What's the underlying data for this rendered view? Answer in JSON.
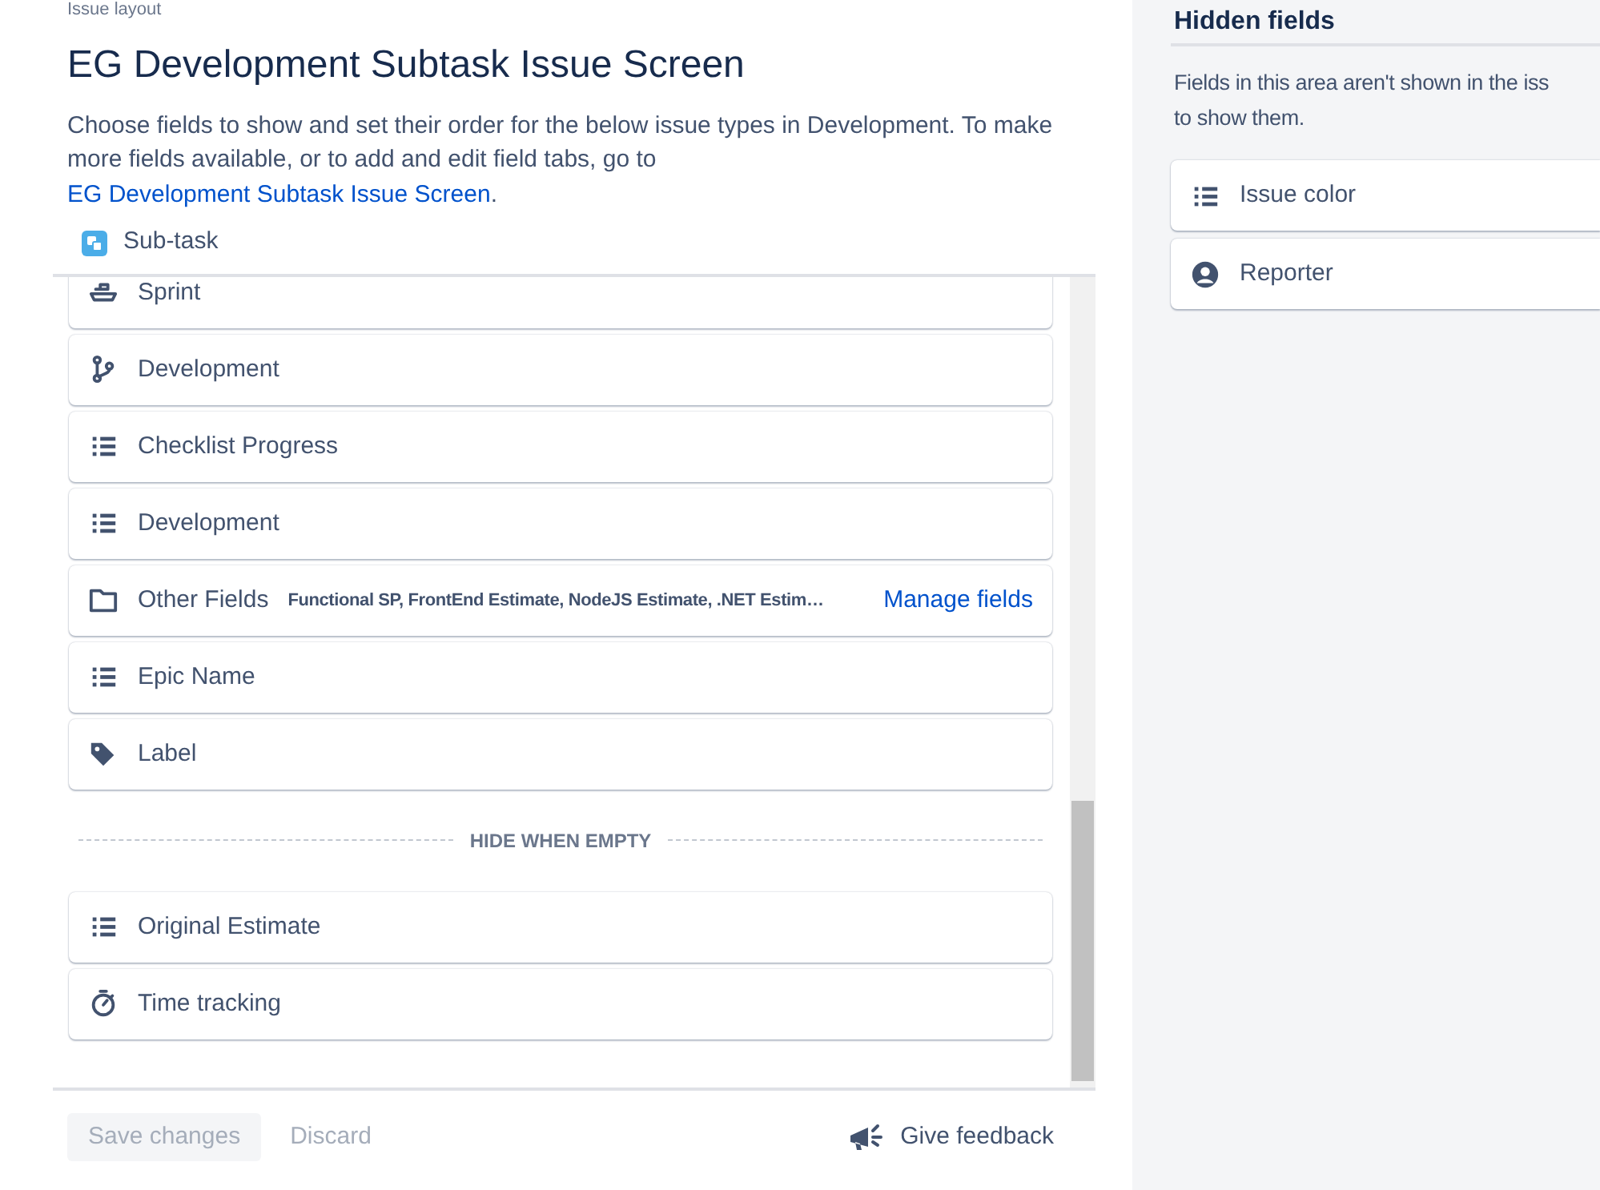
{
  "breadcrumb": "Issue layout",
  "title": "EG Development Subtask Issue Screen",
  "description": {
    "text": "Choose fields to show and set their order for the below issue types in Development. To make more fields available, or to add and edit field tabs, go to",
    "link": "EG Development Subtask Issue Screen",
    "after": "."
  },
  "issue_type": {
    "label": "Sub-task"
  },
  "fields": [
    {
      "kind": "ship",
      "label": "Sprint"
    },
    {
      "kind": "branch",
      "label": "Development"
    },
    {
      "kind": "list",
      "label": "Checklist Progress"
    },
    {
      "kind": "list",
      "label": "Development"
    },
    {
      "kind": "folder",
      "label": "Other Fields",
      "summary": "Functional SP, FrontEnd Estimate, NodeJS Estimate, .NET Estim…",
      "action": "Manage fields"
    },
    {
      "kind": "list",
      "label": "Epic Name"
    },
    {
      "kind": "tag",
      "label": "Label"
    },
    {
      "kind": "divider",
      "label": "HIDE WHEN EMPTY"
    },
    {
      "kind": "list",
      "label": "Original Estimate"
    },
    {
      "kind": "stopwatch",
      "label": "Time tracking"
    }
  ],
  "footer": {
    "save": {
      "label": "Save changes",
      "disabled": true
    },
    "discard": "Discard",
    "feedback": "Give feedback"
  },
  "hidden_fields": {
    "title": "Hidden fields",
    "description_lines": [
      "Fields in this area aren't shown in the iss",
      "to show them."
    ],
    "fields": [
      {
        "kind": "list",
        "label": "Issue color"
      },
      {
        "kind": "user",
        "label": "Reporter"
      }
    ]
  }
}
